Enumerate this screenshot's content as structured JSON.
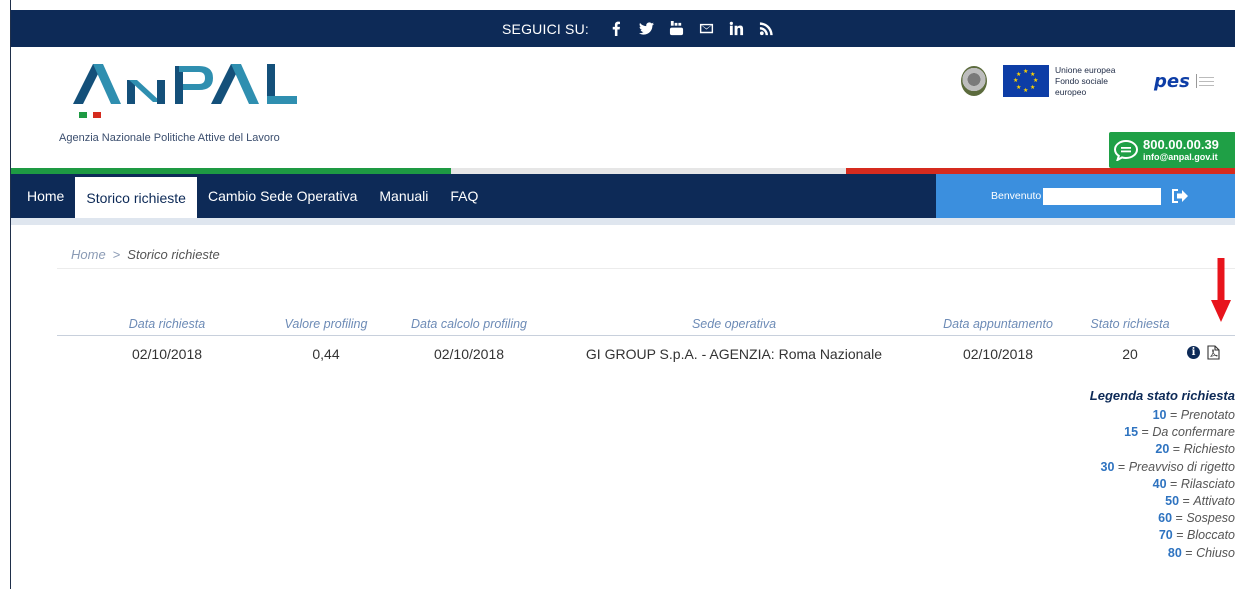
{
  "social": {
    "label": "SEGUICI SU:",
    "icons": [
      "facebook-icon",
      "twitter-icon",
      "youtube-icon",
      "mail-icon",
      "linkedin-icon",
      "rss-icon"
    ]
  },
  "header": {
    "logo_text": "ANPAL",
    "subtitle": "Agenzia Nazionale Politiche Attive del Lavoro",
    "eu_text_line1": "Unione europea",
    "eu_text_line2": "Fondo sociale europeo",
    "pes_text": "pes",
    "contact_number": "800.00.00.39",
    "contact_email": "info@anpal.gov.it"
  },
  "nav": {
    "items": [
      "Home",
      "Storico richieste",
      "Cambio Sede Operativa",
      "Manuali",
      "FAQ"
    ],
    "active_index": 1,
    "welcome": "Benvenuto"
  },
  "breadcrumb": {
    "home": "Home",
    "separator": ">",
    "current": "Storico richieste"
  },
  "table": {
    "headers": [
      "Data richiesta",
      "Valore profiling",
      "Data calcolo profiling",
      "Sede operativa",
      "Data appuntamento",
      "Stato richiesta"
    ],
    "rows": [
      [
        "02/10/2018",
        "0,44",
        "02/10/2018",
        "GI GROUP S.p.A. - AGENZIA: Roma Nazionale",
        "02/10/2018",
        "20"
      ]
    ]
  },
  "legend": {
    "title": "Legenda stato richiesta",
    "items": [
      {
        "code": "10",
        "label": "Prenotato"
      },
      {
        "code": "15",
        "label": "Da confermare"
      },
      {
        "code": "20",
        "label": "Richiesto"
      },
      {
        "code": "30",
        "label": "Preavviso di rigetto"
      },
      {
        "code": "40",
        "label": "Rilasciato"
      },
      {
        "code": "50",
        "label": "Attivato"
      },
      {
        "code": "60",
        "label": "Sospeso"
      },
      {
        "code": "70",
        "label": "Bloccato"
      },
      {
        "code": "80",
        "label": "Chiuso"
      }
    ]
  },
  "colors": {
    "navy": "#0d2a57",
    "blue": "#3b8fde",
    "green": "#1e9a43",
    "red": "#d52b1e",
    "arrow": "#e8141c"
  }
}
